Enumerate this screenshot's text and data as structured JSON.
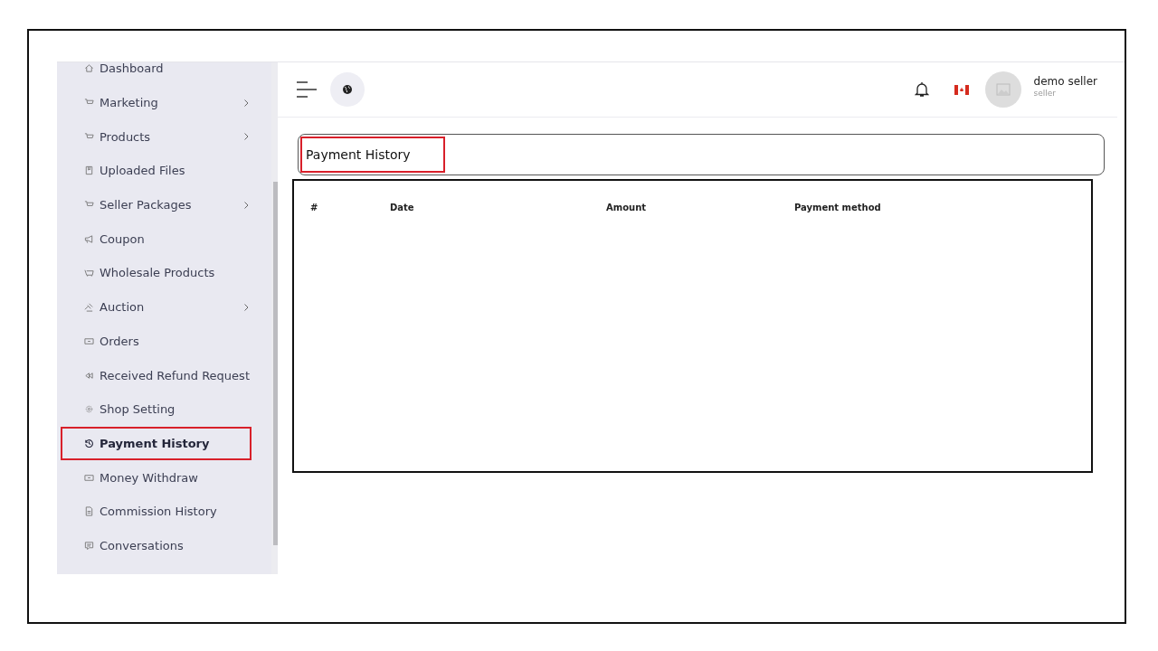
{
  "sidebar": {
    "items": [
      {
        "label": "Dashboard",
        "selected": false,
        "has_submenu": false
      },
      {
        "label": "Marketing",
        "selected": false,
        "has_submenu": true
      },
      {
        "label": "Products",
        "selected": false,
        "has_submenu": true
      },
      {
        "label": "Uploaded Files",
        "selected": false,
        "has_submenu": false
      },
      {
        "label": "Seller Packages",
        "selected": false,
        "has_submenu": true
      },
      {
        "label": "Coupon",
        "selected": false,
        "has_submenu": false
      },
      {
        "label": "Wholesale Products",
        "selected": false,
        "has_submenu": false
      },
      {
        "label": "Auction",
        "selected": false,
        "has_submenu": true
      },
      {
        "label": "Orders",
        "selected": false,
        "has_submenu": false
      },
      {
        "label": "Received Refund Request",
        "selected": false,
        "has_submenu": false
      },
      {
        "label": "Shop Setting",
        "selected": false,
        "has_submenu": false
      },
      {
        "label": "Payment History",
        "selected": true,
        "has_submenu": false,
        "highlighted": true
      },
      {
        "label": "Money Withdraw",
        "selected": false,
        "has_submenu": false
      },
      {
        "label": "Commission History",
        "selected": false,
        "has_submenu": false
      },
      {
        "label": "Conversations",
        "selected": false,
        "has_submenu": false
      }
    ]
  },
  "header": {
    "user_name": "demo seller",
    "user_role": "seller"
  },
  "page_title": {
    "text": "Payment History",
    "highlighted": true
  },
  "table": {
    "columns": [
      "#",
      "Date",
      "Amount",
      "Payment method"
    ]
  }
}
